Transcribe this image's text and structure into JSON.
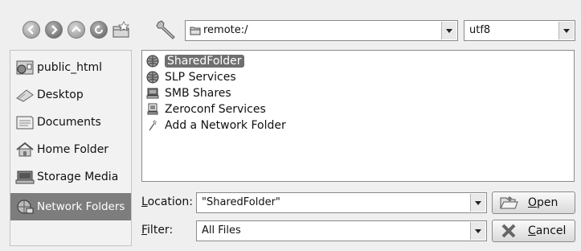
{
  "toolbar": {
    "back_icon": "back-arrow-icon",
    "forward_icon": "forward-arrow-icon",
    "up_icon": "up-arrow-icon",
    "reload_icon": "reload-icon",
    "new_folder_icon": "new-folder-icon",
    "options_icon": "wrench-icon",
    "location_combo": {
      "value": "remote:/"
    },
    "encoding_combo": {
      "value": "utf8"
    }
  },
  "sidebar": {
    "items": [
      {
        "label": "public_html",
        "icon": "web-folder-icon"
      },
      {
        "label": "Desktop",
        "icon": "desktop-icon"
      },
      {
        "label": "Documents",
        "icon": "documents-icon"
      },
      {
        "label": "Home Folder",
        "icon": "home-icon"
      },
      {
        "label": "Storage Media",
        "icon": "storage-media-icon"
      },
      {
        "label": "Network Folders",
        "icon": "network-folder-icon",
        "selected": true
      }
    ]
  },
  "files": [
    {
      "label": "SharedFolder",
      "icon": "network-globe-icon",
      "selected": true
    },
    {
      "label": "SLP Services",
      "icon": "network-globe-icon"
    },
    {
      "label": "SMB Shares",
      "icon": "smb-shares-icon"
    },
    {
      "label": "Zeroconf Services",
      "icon": "zeroconf-icon"
    },
    {
      "label": "Add a Network Folder",
      "icon": "wizard-wand-icon"
    }
  ],
  "location": {
    "label_prefix": "",
    "label_accel": "L",
    "label_rest": "ocation:",
    "value": "\"SharedFolder\""
  },
  "filter": {
    "label_accel": "F",
    "label_rest": "ilter:",
    "value": "All Files"
  },
  "buttons": {
    "open": {
      "accel": "O",
      "rest": "pen"
    },
    "cancel": {
      "accel": "C",
      "rest": "ancel"
    }
  },
  "colors": {
    "selection": "#7d7d7d",
    "background": "#efefef"
  }
}
